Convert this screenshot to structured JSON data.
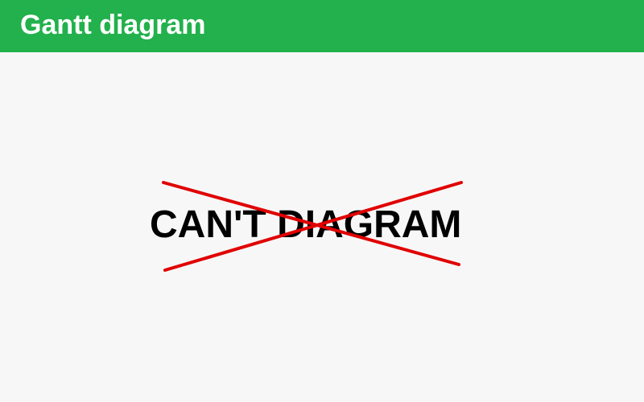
{
  "header": {
    "title": "Gantt diagram",
    "background_color": "#22b14c",
    "text_color": "#ffffff"
  },
  "main": {
    "message": "CAN'T DIAGRAM",
    "message_color": "#000000",
    "cross_color": "#e00000",
    "background_color": "#f7f7f7"
  }
}
